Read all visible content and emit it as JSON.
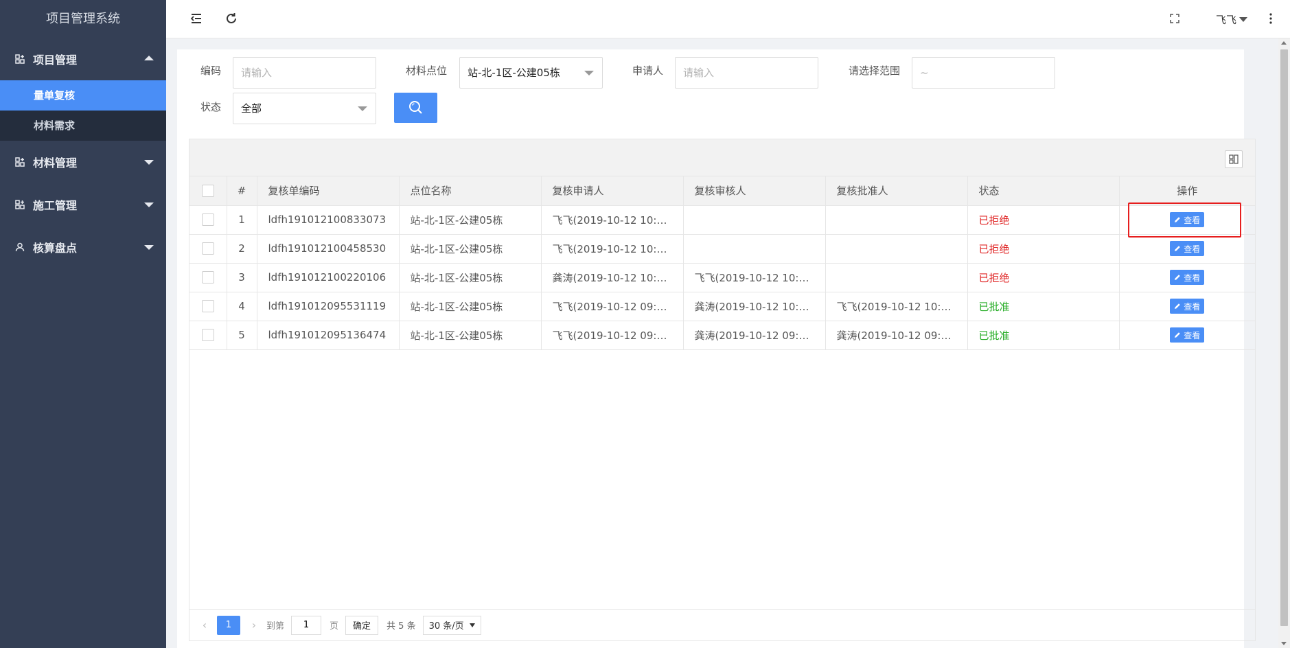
{
  "app": {
    "title": "项目管理系统"
  },
  "sidebar": {
    "groups": [
      {
        "label": "项目管理",
        "expanded": true,
        "items": [
          {
            "label": "量单复核",
            "active": true
          },
          {
            "label": "材料需求",
            "active": false
          }
        ]
      },
      {
        "label": "材料管理",
        "expanded": false
      },
      {
        "label": "施工管理",
        "expanded": false
      },
      {
        "label": "核算盘点",
        "expanded": false
      }
    ]
  },
  "topbar": {
    "user": "飞飞",
    "icons": [
      "menu-collapse-icon",
      "refresh-icon",
      "fullscreen-icon",
      "more-vertical-icon"
    ]
  },
  "filters": {
    "code_label": "编码",
    "code_placeholder": "请输入",
    "location_label": "材料点位",
    "location_value": "站-北-1区-公建05栋",
    "applicant_label": "申请人",
    "applicant_placeholder": "请输入",
    "range_label": "请选择范围",
    "range_placeholder": "~",
    "status_label": "状态",
    "status_value": "全部"
  },
  "table": {
    "columns": [
      "#",
      "复核单编码",
      "点位名称",
      "复核申请人",
      "复核审核人",
      "复核批准人",
      "状态",
      "操作"
    ],
    "rows": [
      {
        "num": "1",
        "code": "ldfh191012100833073",
        "location": "站-北-1区-公建05栋",
        "applicant": "飞飞(2019-10-12 10:0...",
        "reviewer": "",
        "approver": "",
        "status": "已拒绝",
        "status_type": "rejected",
        "action": "查看"
      },
      {
        "num": "2",
        "code": "ldfh191012100458530",
        "location": "站-北-1区-公建05栋",
        "applicant": "飞飞(2019-10-12 10:0...",
        "reviewer": "",
        "approver": "",
        "status": "已拒绝",
        "status_type": "rejected",
        "action": "查看"
      },
      {
        "num": "3",
        "code": "ldfh191012100220106",
        "location": "站-北-1区-公建05栋",
        "applicant": "龚涛(2019-10-12 10:0...",
        "reviewer": "飞飞(2019-10-12 10:0...",
        "approver": "",
        "status": "已拒绝",
        "status_type": "rejected",
        "action": "查看"
      },
      {
        "num": "4",
        "code": "ldfh191012095531119",
        "location": "站-北-1区-公建05栋",
        "applicant": "飞飞(2019-10-12 09:5...",
        "reviewer": "龚涛(2019-10-12 10:1...",
        "approver": "飞飞(2019-10-12 10:1...",
        "status": "已批准",
        "status_type": "approved",
        "action": "查看"
      },
      {
        "num": "5",
        "code": "ldfh191012095136474",
        "location": "站-北-1区-公建05栋",
        "applicant": "飞飞(2019-10-12 09:5...",
        "reviewer": "龚涛(2019-10-12 09:5...",
        "approver": "龚涛(2019-10-12 09:5...",
        "status": "已批准",
        "status_type": "approved",
        "action": "查看"
      }
    ]
  },
  "pager": {
    "current": "1",
    "goto_label": "到第",
    "goto_value": "1",
    "page_unit": "页",
    "confirm": "确定",
    "total": "共 5 条",
    "page_size": "30 条/页"
  },
  "colors": {
    "primary": "#4a8ef6",
    "sidebar": "#343f55",
    "submenu": "#242d3d",
    "rejected": "#e02626",
    "approved": "#27ad27",
    "highlight": "#e61e1e"
  }
}
